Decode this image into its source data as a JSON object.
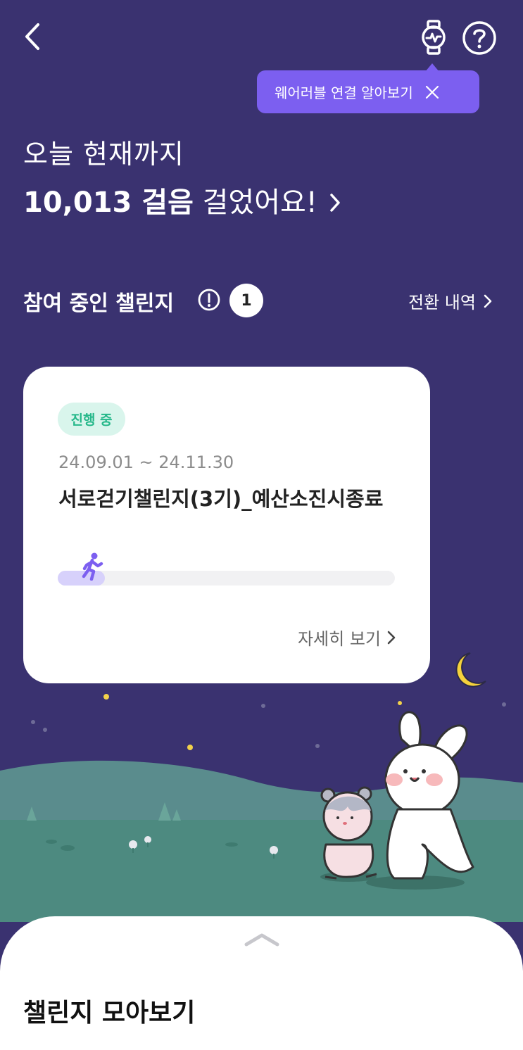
{
  "header": {
    "back_icon": "chevron-left-icon",
    "wearable_icon": "smartwatch-icon",
    "help_icon": "question-circle-icon"
  },
  "tooltip": {
    "text": "웨어러블 연결 알아보기",
    "close_icon": "close-icon",
    "color": "#7c5ff0"
  },
  "greeting": {
    "line1": "오늘 현재까지",
    "steps": "10,013 걸음",
    "suffix": " 걸었어요!"
  },
  "challenges": {
    "section_title": "참여 중인 챌린지",
    "info_icon": "exclamation-circle-icon",
    "count": "1",
    "history_link": "전환 내역",
    "card": {
      "status": "진행 중",
      "period": "24.09.01 ~ 24.11.30",
      "title": "서로걷기챌린지(3기)_예산소진시종료",
      "progress_fraction": 0.14,
      "detail_link": "자세히 보기"
    }
  },
  "bottom_sheet": {
    "title": "챌린지 모아보기",
    "handle_icon": "chevron-up-icon"
  },
  "colors": {
    "background": "#3a3270",
    "accent": "#7c5ff0",
    "status_green": "#26b88a",
    "moon": "#f5d23c"
  }
}
